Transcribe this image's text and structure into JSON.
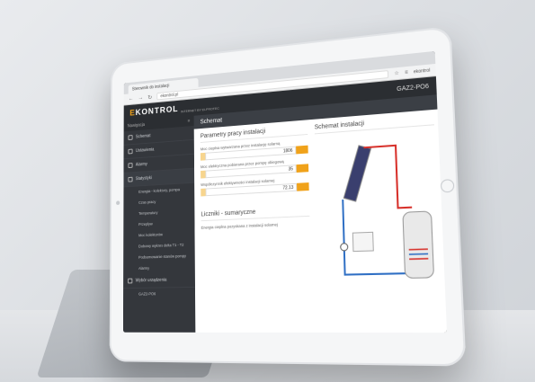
{
  "browser": {
    "tab_title": "Sterownik do instalacji",
    "url": "ekontrol.pl",
    "user": "ekontrol"
  },
  "app": {
    "logo_e": "E",
    "logo_rest": "KONTROL",
    "logo_sub": "INTERNET BY ELPROTEC",
    "device": "GAZ2-PO6",
    "section_title": "Schemat"
  },
  "sidebar": {
    "header": "Nawigacja",
    "items": [
      {
        "label": "Schemat"
      },
      {
        "label": "Ustawienia"
      },
      {
        "label": "Alarmy"
      },
      {
        "label": "Statystyki"
      }
    ],
    "subitems": [
      "Energia - kolektory, pompa",
      "Czas pracy",
      "Temperatury",
      "Przepływ",
      "Moc kolektorów",
      "Dobowy wykres delta T1 - T2",
      "Podsumowanie stanów pompy",
      "Alarmy"
    ],
    "footer_item": "Wybór urządzenia",
    "footer_device": "GAZ2-PO6"
  },
  "panel_left": {
    "title": "Parametry pracy instalacji",
    "fields": [
      {
        "label": "Moc cieplna wytwarzana przez instalację solarną",
        "value": "1806"
      },
      {
        "label": "Moc elektryczna pobierana przez pompę obiegową",
        "value": "35"
      },
      {
        "label": "Współczynnik efektywności instalacji solarnej",
        "value": "72.13"
      }
    ],
    "counters_title": "Liczniki - sumaryczne",
    "counters_label": "Energia cieplna pozyskana z instalacji solarnej"
  },
  "panel_right": {
    "title": "Schemat instalacji"
  },
  "colors": {
    "accent": "#f0a21a",
    "hot_pipe": "#d7312b",
    "cold_pipe": "#2f6fc4",
    "dark": "#2b2e32"
  }
}
